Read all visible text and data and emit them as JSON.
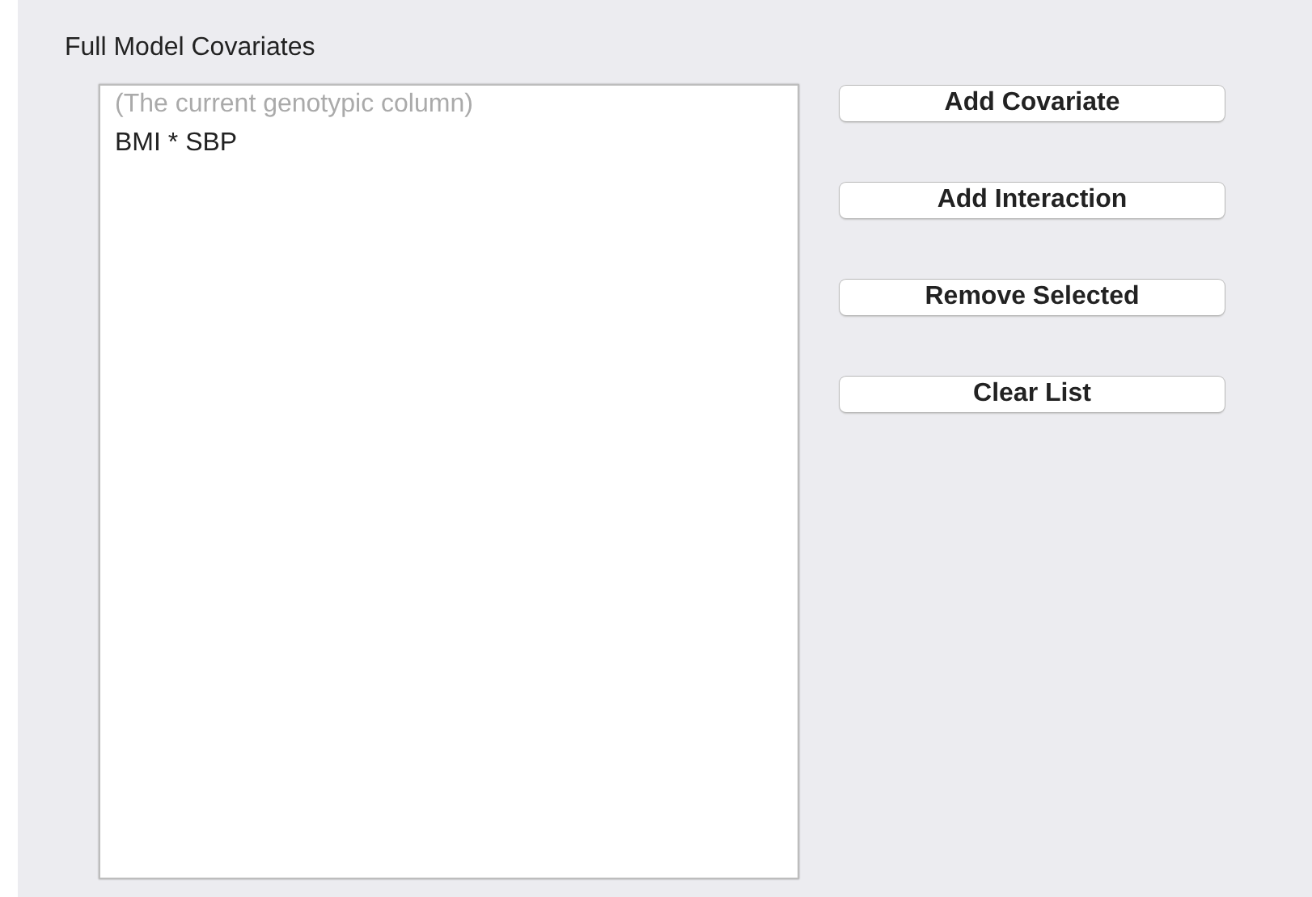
{
  "group": {
    "title": "Full Model Covariates"
  },
  "list": {
    "items": [
      {
        "label": "(The current genotypic column)",
        "disabled": true
      },
      {
        "label": "BMI * SBP",
        "disabled": false
      }
    ]
  },
  "buttons": [
    {
      "label": "Add Covariate"
    },
    {
      "label": "Add Interaction"
    },
    {
      "label": "Remove Selected"
    },
    {
      "label": "Clear List"
    }
  ]
}
